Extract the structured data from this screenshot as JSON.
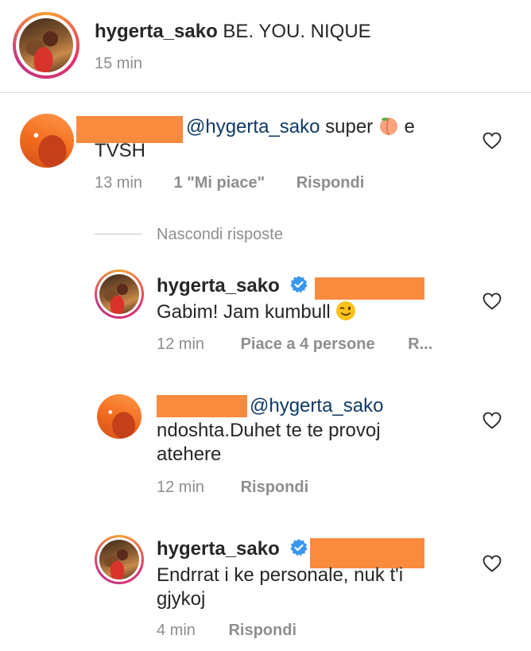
{
  "caption": {
    "username": "hygerta_sako",
    "text": "BE. YOU. NIQUE",
    "time": "15 min"
  },
  "comments": [
    {
      "mention": "@hygerta_sako",
      "text": "super",
      "text_after_emoji": "e",
      "text_line2": "TVSH",
      "emoji": "peach-emoji",
      "time": "13 min",
      "likes": "1 \"Mi piace\"",
      "reply": "Rispondi"
    }
  ],
  "hide_replies": "Nascondi risposte",
  "replies": [
    {
      "username": "hygerta_sako",
      "verified": true,
      "text": "Gabim! Jam kumbull",
      "emoji": "wink-emoji",
      "time": "12 min",
      "likes": "Piace a 4 persone",
      "reply": "R..."
    },
    {
      "mention": "@hygerta_sako",
      "text_line1": "ndoshta.Duhet te te provoj",
      "text_line2": "atehere",
      "time": "12 min",
      "reply": "Rispondi"
    },
    {
      "username": "hygerta_sako",
      "verified": true,
      "text_line1": "Endrrat i ke personale, nuk t'i",
      "text_line2": "gjykoj",
      "time": "4 min",
      "reply": "Rispondi"
    }
  ],
  "colors": {
    "redaction": "#f98a3e",
    "mention": "#0f3a66",
    "meta": "#8e8e8e",
    "verified": "#3897f0"
  }
}
